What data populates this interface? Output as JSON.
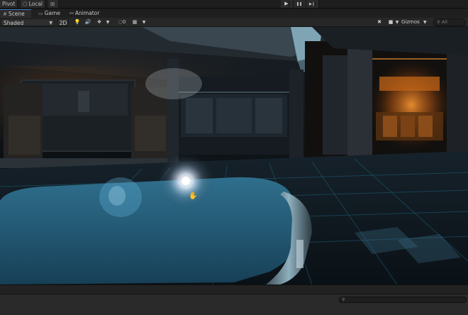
{
  "toolbar": {
    "pivot_label": "Pivot",
    "local_label": "Local",
    "play_icon": "▶",
    "pause_icon": "❚❚",
    "step_icon": "▶❙"
  },
  "tabs": [
    {
      "label": "Scene",
      "icon": "#",
      "active": true
    },
    {
      "label": "Game",
      "icon": "▭",
      "active": false
    },
    {
      "label": "Animator",
      "icon": "⚯",
      "active": false
    }
  ],
  "scene_toolbar": {
    "shading_mode": "Shaded",
    "view_2d_label": "2D",
    "hidden_count": "0",
    "gizmos_label": "Gizmos",
    "search_placeholder": "All"
  },
  "bottom": {
    "search_icon": "⚲"
  },
  "colors": {
    "editor_bg": "#191919",
    "tab_accent": "#3a79bb",
    "orange_light": "#e07a1c",
    "floor_cyan": "#3f8fb0"
  }
}
